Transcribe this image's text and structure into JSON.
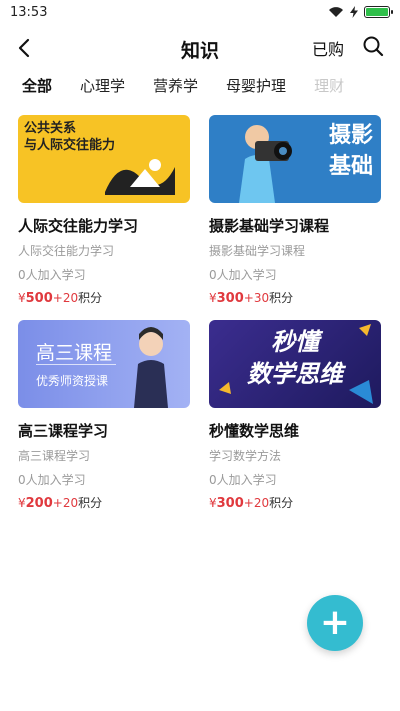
{
  "status": {
    "time": "13:53",
    "battery_level": 1.0
  },
  "nav": {
    "title": "知识",
    "bought_label": "已购"
  },
  "tabs": [
    {
      "label": "全部",
      "active": true
    },
    {
      "label": "心理学",
      "active": false
    },
    {
      "label": "营养学",
      "active": false
    },
    {
      "label": "母婴护理",
      "active": false
    },
    {
      "label": "理财",
      "active": false
    }
  ],
  "courses": [
    {
      "title": "人际交往能力学习",
      "subtitle": "人际交往能力学习",
      "learners": "0人加入学习",
      "currency": "¥",
      "price": "500",
      "points": "+20",
      "points_label": "积分",
      "thumb_lines": [
        "公共关系",
        "与人际交往能力"
      ]
    },
    {
      "title": "摄影基础学习课程",
      "subtitle": "摄影基础学习课程",
      "learners": "0人加入学习",
      "currency": "¥",
      "price": "300",
      "points": "+30",
      "points_label": "积分",
      "thumb_lines": [
        "摄影",
        "基础"
      ]
    },
    {
      "title": "高三课程学习",
      "subtitle": "高三课程学习",
      "learners": "0人加入学习",
      "currency": "¥",
      "price": "200",
      "points": "+20",
      "points_label": "积分",
      "thumb_lines": [
        "高三课程",
        "优秀师资授课"
      ]
    },
    {
      "title": "秒懂数学思维",
      "subtitle": "学习数学方法",
      "learners": "0人加入学习",
      "currency": "¥",
      "price": "300",
      "points": "+20",
      "points_label": "积分",
      "thumb_lines": [
        "秒懂",
        "数学思维"
      ]
    }
  ],
  "fab": {
    "label": "+"
  },
  "colors": {
    "accent": "#2ec5dc",
    "price": "#e0393e",
    "fab": "#34bcd0"
  }
}
